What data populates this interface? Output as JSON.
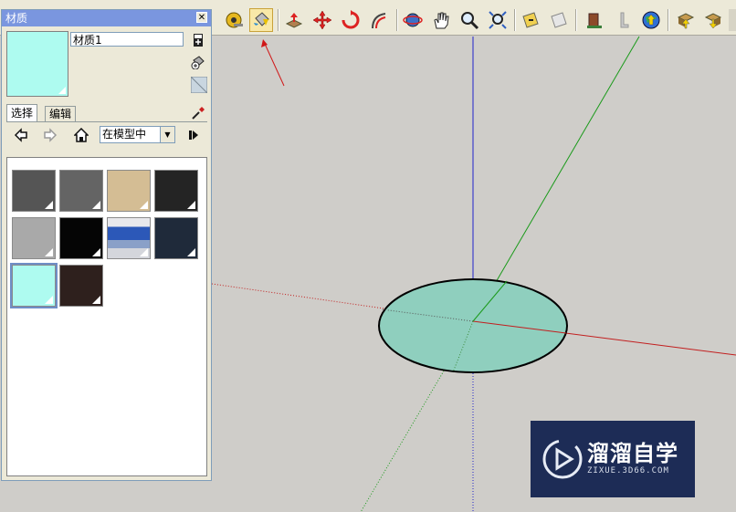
{
  "toolbar": {
    "tools": [
      {
        "name": "tape-measure-icon"
      },
      {
        "name": "paint-bucket-icon",
        "active": true
      },
      {
        "name": "push-pull-icon"
      },
      {
        "name": "move-icon"
      },
      {
        "name": "rotate-icon"
      },
      {
        "name": "follow-me-icon"
      },
      {
        "name": "orbit-icon"
      },
      {
        "name": "pan-icon"
      },
      {
        "name": "zoom-icon"
      },
      {
        "name": "zoom-extents-icon"
      },
      {
        "name": "section-plane-icon"
      },
      {
        "name": "display-section-icon"
      },
      {
        "name": "get-models-icon"
      },
      {
        "name": "walk-icon"
      },
      {
        "name": "google-earth-icon"
      },
      {
        "name": "get-photo-icon"
      },
      {
        "name": "share-model-icon"
      }
    ]
  },
  "materials_panel": {
    "title": "材质",
    "material_name": "材质1",
    "preview_color": "#aefbf0",
    "tabs": [
      {
        "label": "选择"
      },
      {
        "label": "编辑"
      }
    ],
    "collection": "在模型中",
    "swatches": [
      {
        "color": "#555555"
      },
      {
        "color": "#646464"
      },
      {
        "color": "#d4bd94"
      },
      {
        "color": "#242424"
      },
      {
        "color": "#a9a9a9"
      },
      {
        "color": "#050505"
      },
      {
        "color": "#8c9cc4",
        "texture": true
      },
      {
        "color": "#1f2a3a"
      },
      {
        "color": "#aefbf0",
        "selected": true
      },
      {
        "color": "#2e201d"
      }
    ]
  },
  "scene": {
    "circle_fill": "#8fcfbe",
    "axis_red": "#c21f1f",
    "axis_green": "#1a9a1a",
    "axis_blue": "#2222cc"
  },
  "watermark": {
    "text": "溜溜自学",
    "url": "ZIXUE.3D66.COM"
  }
}
